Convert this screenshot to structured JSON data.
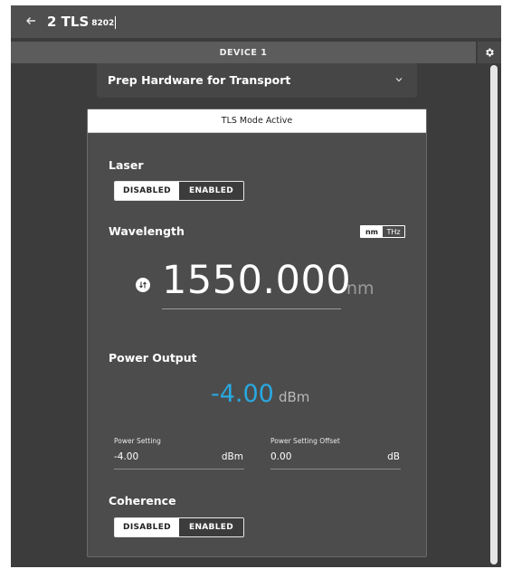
{
  "header": {
    "title": "2 TLS",
    "subtitle": "8202",
    "back_icon": "arrow-left-icon"
  },
  "device_bar": {
    "label": "DEVICE 1",
    "settings_icon": "gear-icon"
  },
  "prep_panel": {
    "title": "Prep Hardware for Transport",
    "chevron_icon": "chevron-down-icon"
  },
  "card": {
    "header": "TLS Mode Active",
    "laser": {
      "title": "Laser",
      "options": [
        "DISABLED",
        "ENABLED"
      ],
      "selected": "DISABLED"
    },
    "wavelength": {
      "title": "Wavelength",
      "unit_options": [
        "nm",
        "THz"
      ],
      "selected_unit": "nm",
      "value": "1550.000",
      "unit": "nm",
      "swap_icon": "swap-icon"
    },
    "power_output": {
      "title": "Power Output",
      "value": "-4.00",
      "unit": "dBm",
      "value_color": "#29a8e0"
    },
    "power_setting": {
      "label": "Power Setting",
      "value": "-4.00",
      "unit": "dBm"
    },
    "power_setting_offset": {
      "label": "Power Setting Offset",
      "value": "0.00",
      "unit": "dB"
    },
    "coherence": {
      "title": "Coherence",
      "options": [
        "DISABLED",
        "ENABLED"
      ],
      "selected": "DISABLED"
    }
  }
}
